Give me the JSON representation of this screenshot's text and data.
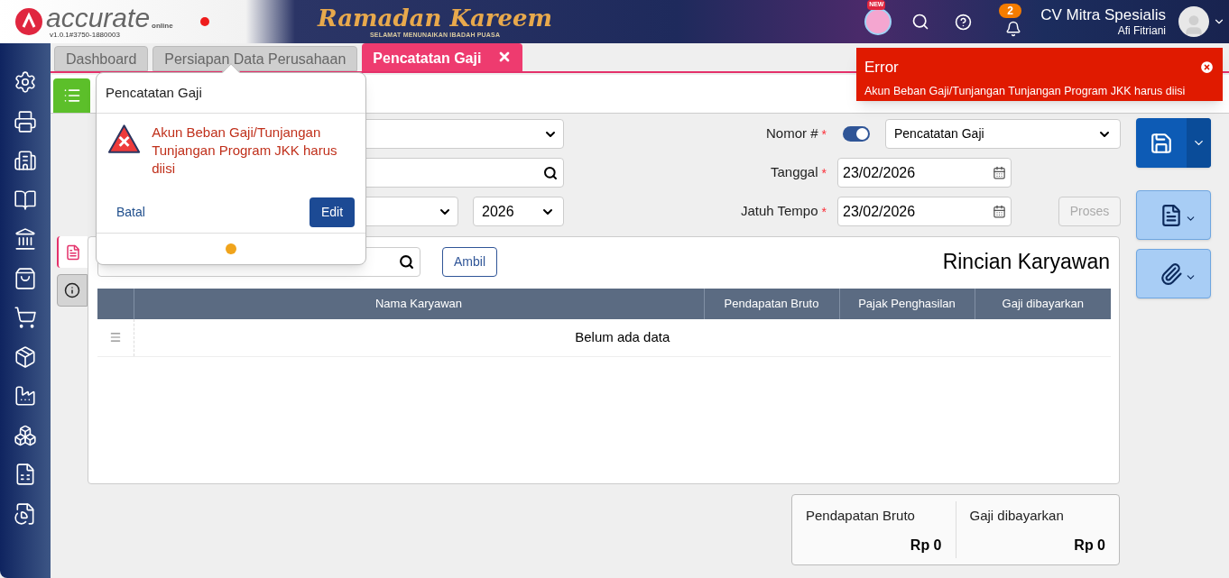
{
  "header": {
    "logo_text": "accurate",
    "logo_sub": "online",
    "version": "v1.0.1#3750-1880003",
    "banner": {
      "title": "Ramadan Kareem",
      "subtitle": "SELAMAT MENUNAIKAN IBADAH PUASA"
    },
    "new_badge": "NEW",
    "notification_count": "2",
    "company": "CV Mitra Spesialis",
    "user": "Afi Fitriani"
  },
  "tabs": [
    {
      "label": "Dashboard",
      "selected": false,
      "closable": false
    },
    {
      "label": "Persiapan Data Perusahaan",
      "selected": false,
      "closable": false
    },
    {
      "label": "Pencatatan Gaji",
      "selected": true,
      "closable": true
    }
  ],
  "form": {
    "nomor": {
      "label": "Nomor #",
      "required": true,
      "auto_number": true,
      "value": "Pencatatan Gaji"
    },
    "tanggal": {
      "label": "Tanggal",
      "required": true,
      "value": "23/02/2026"
    },
    "jatuh_tempo": {
      "label": "Jatuh Tempo",
      "required": true,
      "value": "23/02/2026"
    },
    "year": "2026",
    "required_mark": "*",
    "process_button": {
      "label": "Proses",
      "disabled": true
    }
  },
  "side_tabs": [
    {
      "kind": "document",
      "selected": true
    },
    {
      "kind": "info",
      "selected": false
    }
  ],
  "detail": {
    "title": "Rincian Karyawan",
    "fetch_button": "Ambil",
    "columns": [
      "Nama Karyawan",
      "Pendapatan Bruto",
      "Pajak Penghasilan",
      "Gaji dibayarkan"
    ],
    "empty_text": "Belum ada data"
  },
  "summary": [
    {
      "label": "Pendapatan Bruto",
      "value": "Rp 0"
    },
    {
      "label": "Gaji dibayarkan",
      "value": "Rp 0"
    }
  ],
  "popover": {
    "title": "Pencatatan Gaji",
    "message": "Akun Beban Gaji/Tunjangan Tunjangan Program JKK harus diisi",
    "cancel": "Batal",
    "confirm": "Edit"
  },
  "toast": {
    "title": "Error",
    "message": "Akun Beban Gaji/Tunjangan Tunjangan Program JKK harus diisi"
  }
}
